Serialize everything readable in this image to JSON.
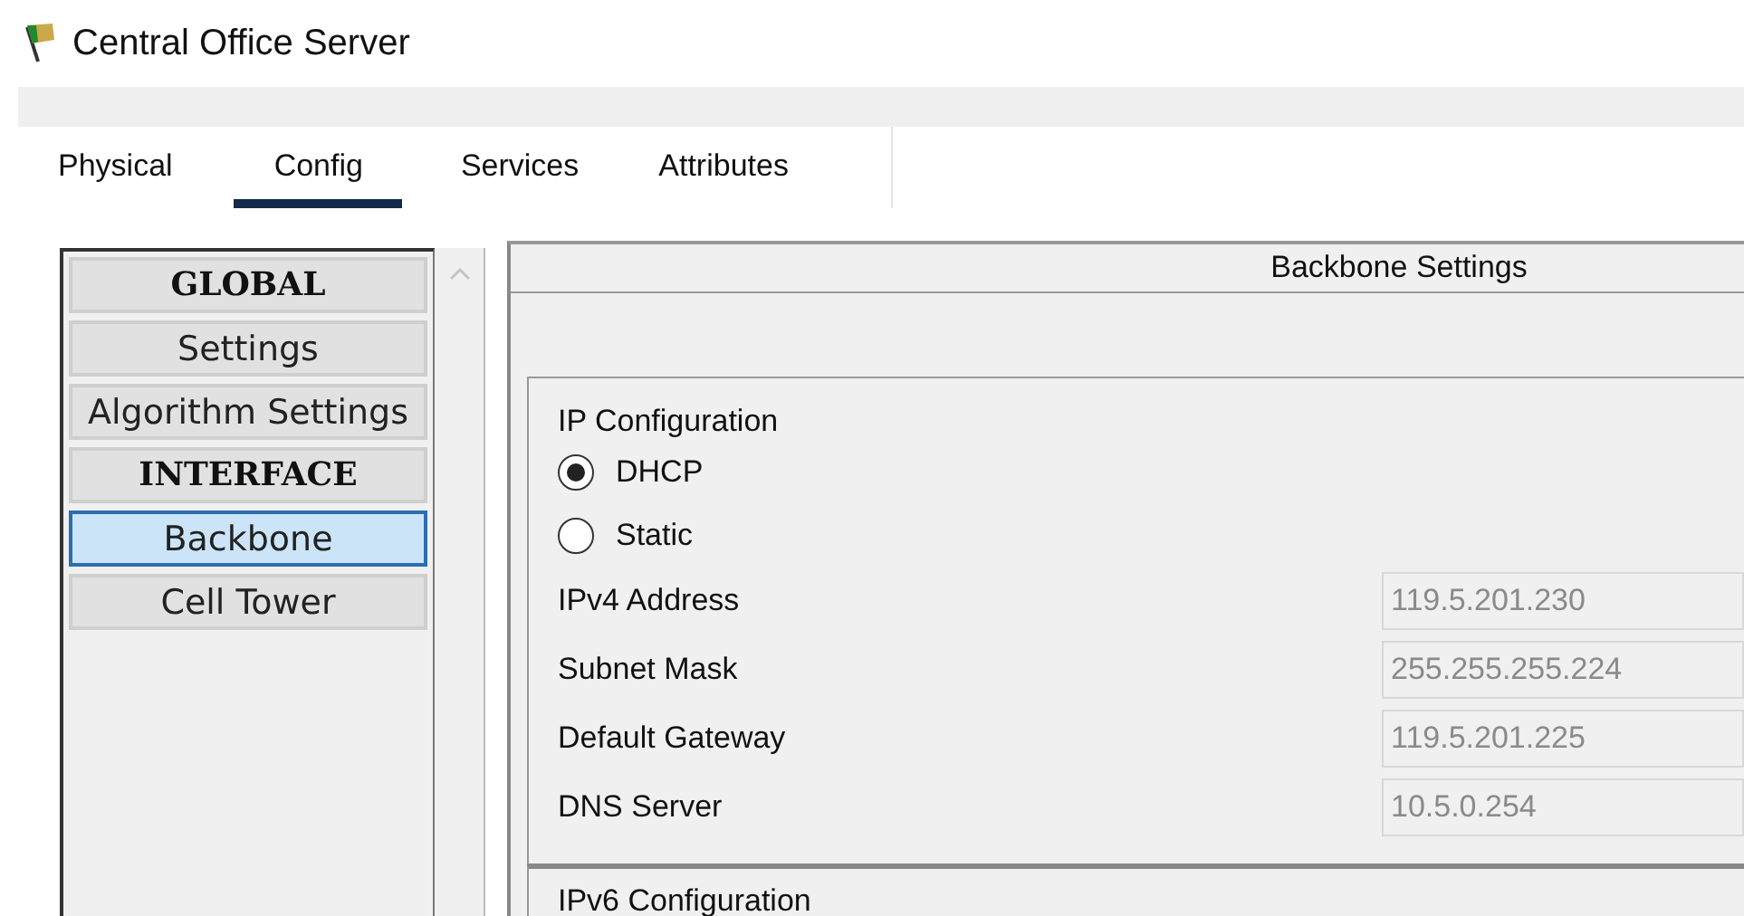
{
  "window": {
    "title": "Central Office Server"
  },
  "tabs": [
    {
      "label": "Physical",
      "selected": false
    },
    {
      "label": "Config",
      "selected": true
    },
    {
      "label": "Services",
      "selected": false
    },
    {
      "label": "Attributes",
      "selected": false
    }
  ],
  "sidebar": {
    "items": [
      {
        "kind": "header",
        "label": "GLOBAL",
        "selected": false
      },
      {
        "kind": "item",
        "label": "Settings",
        "selected": false
      },
      {
        "kind": "item",
        "label": "Algorithm Settings",
        "selected": false
      },
      {
        "kind": "header",
        "label": "INTERFACE",
        "selected": false
      },
      {
        "kind": "item",
        "label": "Backbone",
        "selected": true
      },
      {
        "kind": "item",
        "label": "Cell Tower",
        "selected": false
      }
    ]
  },
  "panel": {
    "title": "Backbone Settings",
    "ip_configuration": {
      "title": "IP Configuration",
      "modes": [
        {
          "label": "DHCP",
          "selected": true
        },
        {
          "label": "Static",
          "selected": false
        }
      ],
      "fields": [
        {
          "label": "IPv4 Address",
          "value": "119.5.201.230",
          "disabled": true
        },
        {
          "label": "Subnet Mask",
          "value": "255.255.255.224",
          "disabled": true
        },
        {
          "label": "Default Gateway",
          "value": "119.5.201.225",
          "disabled": true
        },
        {
          "label": "DNS Server",
          "value": "10.5.0.254",
          "disabled": true
        }
      ]
    },
    "ipv6_configuration": {
      "title": "IPv6 Configuration"
    }
  }
}
